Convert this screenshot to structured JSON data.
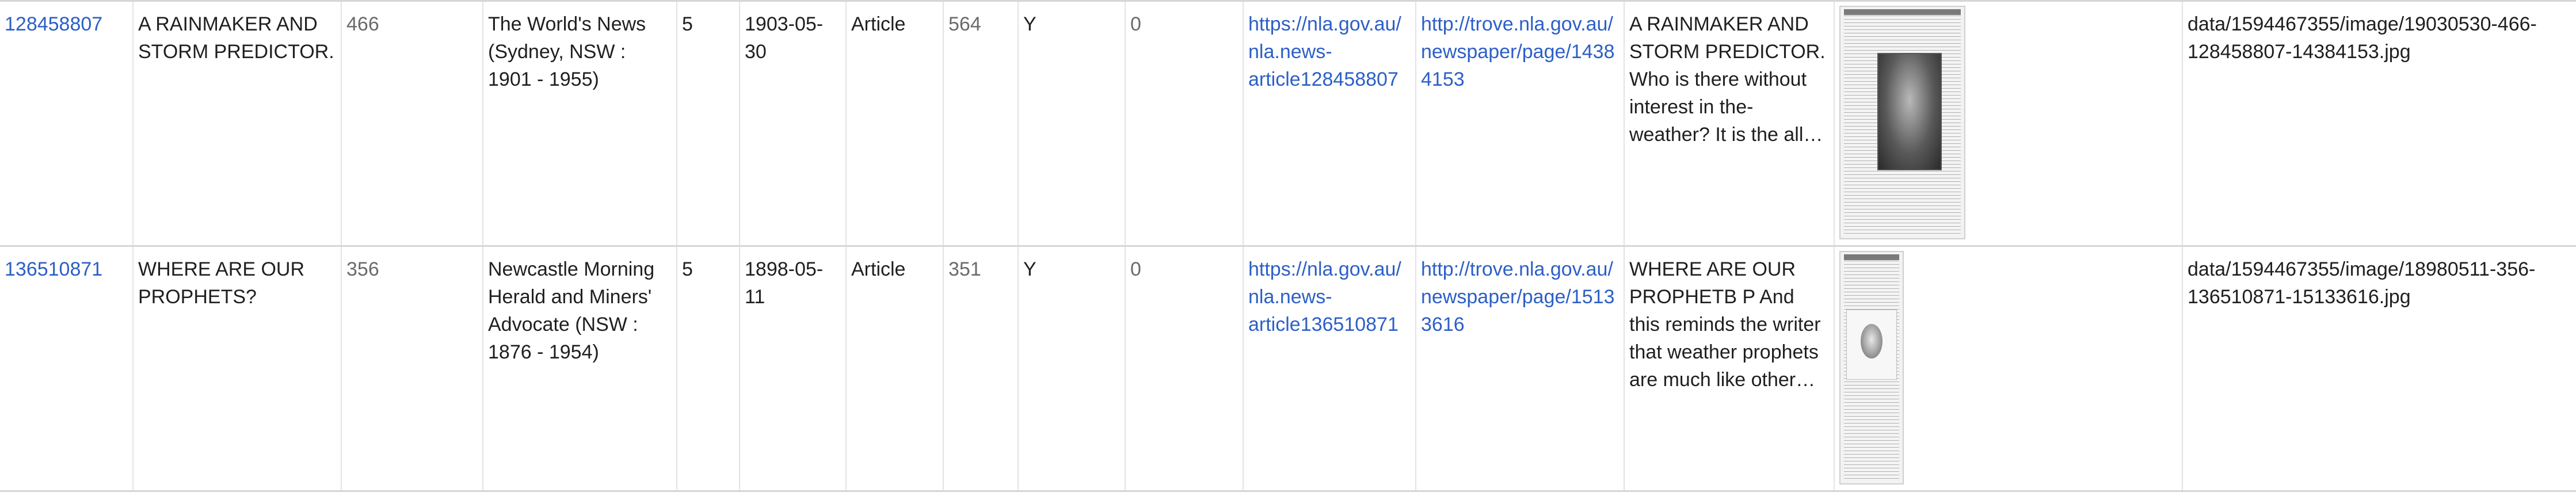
{
  "rows": [
    {
      "id": "128458807",
      "title": "A RAINMAKER AND STORM PREDICTOR.",
      "page_num": "466",
      "newspaper": "The World's News (Sydney, NSW : 1901 - 1955)",
      "page_no": "5",
      "date": "1903-05-30",
      "category": "Article",
      "words": "564",
      "illustrated": "Y",
      "corrections": "0",
      "article_url": "https://nla.gov.au/nla.news-article128458807",
      "page_url": "http://trove.nla.gov.au/newspaper/page/14384153",
      "text": "A RAINMAKER AND STORM PREDICTOR. Who is there without interest in the-weather? It is the all-import…",
      "thumbnail_icon": "newspaper-page-thumbnail",
      "image_path": "data/1594467355/image/19030530-466-128458807-14384153.jpg"
    },
    {
      "id": "136510871",
      "title": "WHERE ARE OUR PROPHETS?",
      "page_num": "356",
      "newspaper": "Newcastle Morning Herald and Miners' Advocate (NSW : 1876 - 1954)",
      "page_no": "5",
      "date": "1898-05-11",
      "category": "Article",
      "words": "351",
      "illustrated": "Y",
      "corrections": "0",
      "article_url": "https://nla.gov.au/nla.news-article136510871",
      "page_url": "http://trove.nla.gov.au/newspaper/page/15133616",
      "text": "WHERE ARE OUR PROPHETB P And this reminds the writer that weather prophets are much like other prop…",
      "thumbnail_icon": "newspaper-page-thumbnail",
      "image_path": "data/1594467355/image/18980511-356-136510871-15133616.jpg"
    }
  ]
}
